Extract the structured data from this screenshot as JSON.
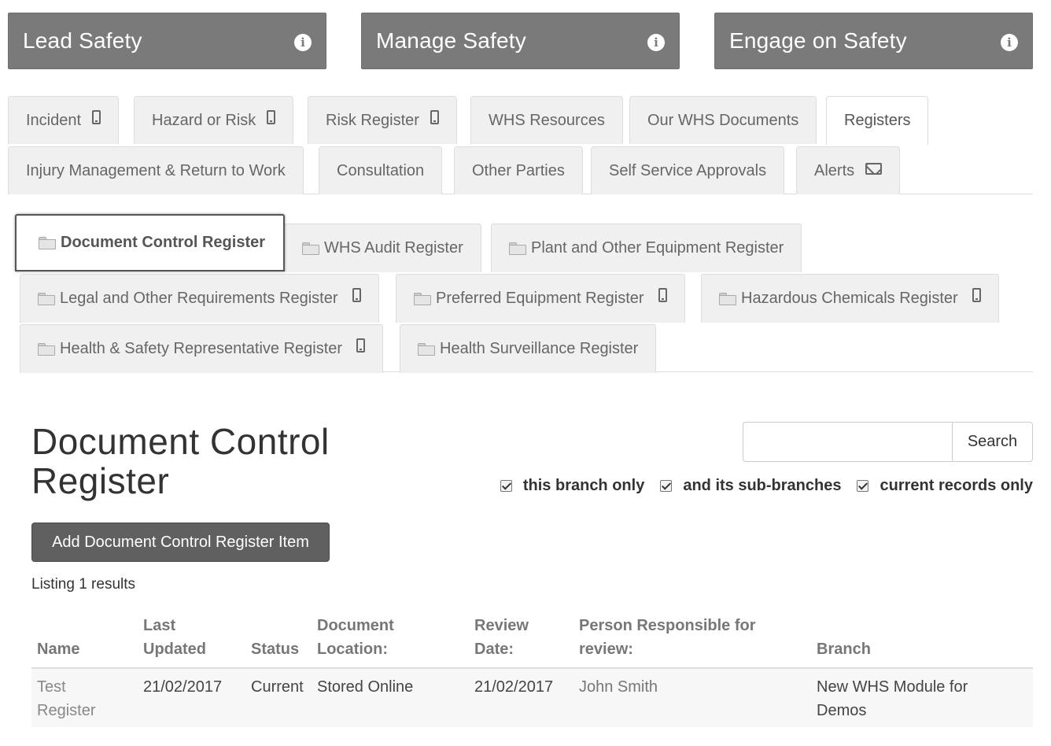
{
  "tiles": [
    {
      "label": "Lead Safety",
      "icon": "info-icon"
    },
    {
      "label": "Manage Safety",
      "icon": "info-icon"
    },
    {
      "label": "Engage on Safety",
      "icon": "info-icon"
    }
  ],
  "tabs": {
    "incident": "Incident",
    "hazard": "Hazard or Risk",
    "risk_register": "Risk Register",
    "whs_resources": "WHS Resources",
    "our_whs_documents": "Our WHS Documents",
    "registers": "Registers",
    "injury_management": "Injury Management & Return to Work",
    "consultation": "Consultation",
    "other_parties": "Other Parties",
    "self_service": "Self Service Approvals",
    "alerts": "Alerts",
    "active": "Registers"
  },
  "subtabs": {
    "document_control": "Document Control Register",
    "whs_audit": "WHS Audit Register",
    "plant_equipment": "Plant and Other Equipment Register",
    "legal_requirements": "Legal and Other Requirements Register",
    "preferred_equipment": "Preferred Equipment Register",
    "hazardous_chemicals": "Hazardous Chemicals Register",
    "hsr": "Health & Safety Representative Register",
    "health_surveillance": "Health Surveillance Register",
    "active": "Document Control Register"
  },
  "page": {
    "title_line1": "Document Control",
    "title_line2": "Register",
    "search_button": "Search",
    "search_value": "",
    "filters": {
      "branch_only": "this branch only",
      "sub_branches": "and its sub-branches",
      "current_only": "current records only"
    },
    "add_button": "Add Document Control Register Item",
    "listing": "Listing 1 results"
  },
  "table": {
    "headers": {
      "name": "Name",
      "last_updated_1": "Last",
      "last_updated_2": "Updated",
      "status": "Status",
      "location_1": "Document",
      "location_2": "Location:",
      "review_1": "Review",
      "review_2": "Date:",
      "person_1": "Person Responsible for",
      "person_2": "review:",
      "branch": "Branch"
    },
    "rows": [
      {
        "name_1": "Test",
        "name_2": "Register",
        "last_updated": "21/02/2017",
        "status": "Current",
        "location": "Stored Online",
        "review_date": "21/02/2017",
        "person": "John Smith",
        "branch_1": "New WHS Module for",
        "branch_2": "Demos"
      }
    ]
  }
}
